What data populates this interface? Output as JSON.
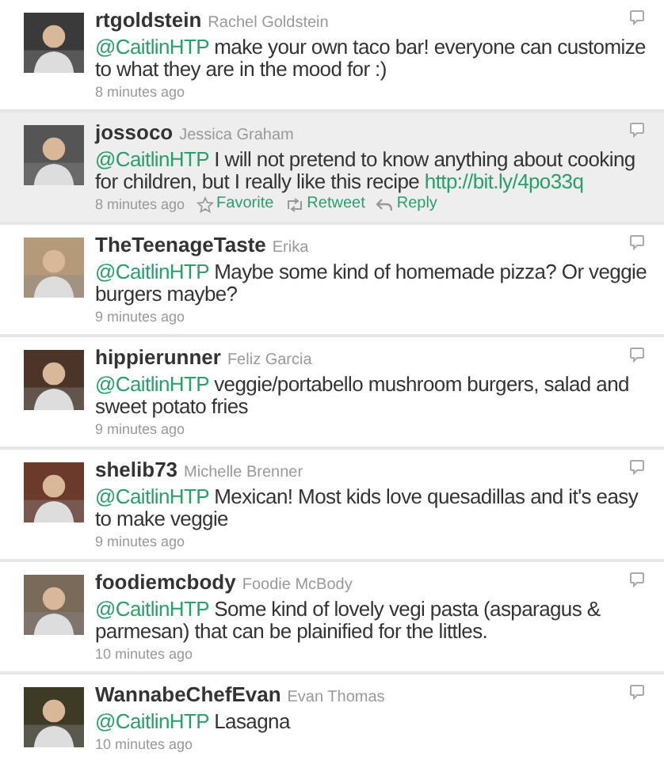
{
  "tweets": [
    {
      "username": "rtgoldstein",
      "full_name": "Rachel Goldstein",
      "mention": "@CaitlinHTP",
      "text": "make your own taco bar! everyone can customize to what they are in the mood for :)",
      "time": "8 minutes ago",
      "highlighted": false
    },
    {
      "username": "jossoco",
      "full_name": "Jessica Graham",
      "mention": "@CaitlinHTP",
      "text": "I will not pretend to know anything about cooking for children, but I really like this recipe",
      "link": "http://bit.ly/4po33q",
      "time": "8 minutes ago",
      "highlighted": true,
      "actions": [
        {
          "kind": "favorite",
          "label": "Favorite"
        },
        {
          "kind": "retweet",
          "label": "Retweet"
        },
        {
          "kind": "reply",
          "label": "Reply"
        }
      ]
    },
    {
      "username": "TheTeenageTaste",
      "full_name": "Erika",
      "mention": "@CaitlinHTP",
      "text": "Maybe some kind of homemade pizza? Or veggie burgers maybe?",
      "time": "9 minutes ago",
      "highlighted": false
    },
    {
      "username": "hippierunner",
      "full_name": "Feliz Garcia",
      "mention": "@CaitlinHTP",
      "text": "veggie/portabello mushroom burgers, salad and sweet potato fries",
      "time": "9 minutes ago",
      "highlighted": false
    },
    {
      "username": "shelib73",
      "full_name": "Michelle Brenner",
      "mention": "@CaitlinHTP",
      "text": "Mexican! Most kids love quesadillas and it's easy to make veggie",
      "time": "9 minutes ago",
      "highlighted": false
    },
    {
      "username": "foodiemcbody",
      "full_name": "Foodie McBody",
      "mention": "@CaitlinHTP",
      "text": "Some kind of lovely vegi pasta (asparagus & parmesan) that can be plainified for the littles.",
      "time": "10 minutes ago",
      "highlighted": false
    },
    {
      "username": "WannabeChefEvan",
      "full_name": "Evan Thomas",
      "mention": "@CaitlinHTP",
      "text": "Lasagna",
      "time": "10 minutes ago",
      "highlighted": false
    }
  ]
}
